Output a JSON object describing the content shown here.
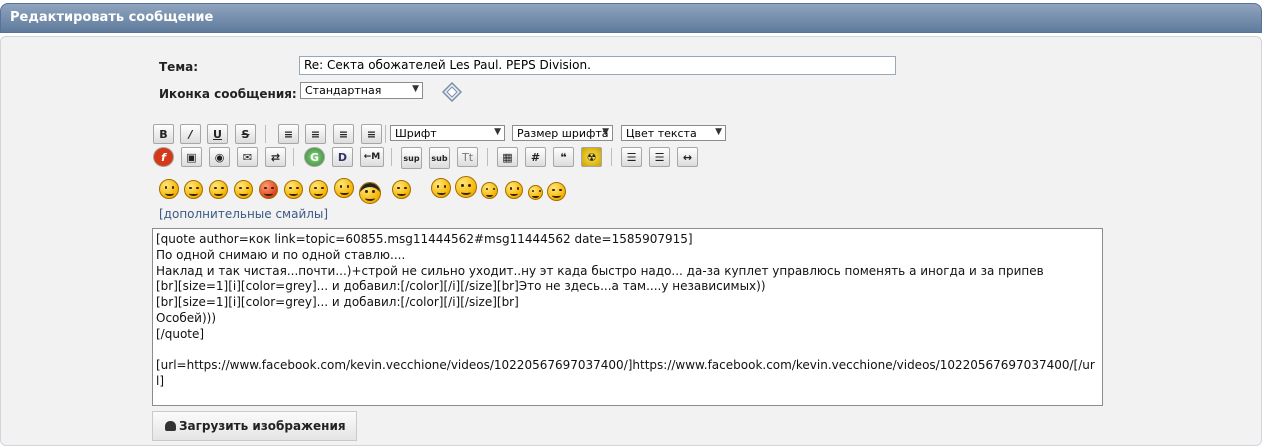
{
  "window": {
    "title": "Редактировать сообщение"
  },
  "form": {
    "subject_label": "Тема:",
    "subject_value": "Re: Секта обожателей Les Paul. PEPS Division.",
    "icon_label": "Иконка сообщения:",
    "icon_value": "Стандартная"
  },
  "toolbar": {
    "font_select": "Шрифт",
    "size_select": "Размер шрифта",
    "color_select": "Цвет текста",
    "row1_buttons": [
      {
        "name": "bold-button",
        "glyph": "B"
      },
      {
        "name": "italic-button",
        "glyph": "/"
      },
      {
        "name": "underline-button",
        "glyph": "U"
      },
      {
        "name": "strike-button",
        "glyph": "S"
      },
      {
        "name": "align-left-button",
        "glyph": "≡"
      },
      {
        "name": "align-justify-button",
        "glyph": "≡"
      },
      {
        "name": "align-center-button",
        "glyph": "≡"
      },
      {
        "name": "align-right-button",
        "glyph": "≡"
      }
    ],
    "row2_buttons": [
      {
        "name": "flash-button",
        "glyph": "f"
      },
      {
        "name": "image-button",
        "glyph": "▣"
      },
      {
        "name": "link-button",
        "glyph": "◉"
      },
      {
        "name": "email-button",
        "glyph": "✉"
      },
      {
        "name": "ftp-button",
        "glyph": "⇄"
      },
      {
        "name": "glow-button",
        "glyph": "G"
      },
      {
        "name": "shadow-button",
        "glyph": "D"
      },
      {
        "name": "marquee-button",
        "glyph": "←M"
      },
      {
        "name": "superscript-button",
        "glyph": "sup"
      },
      {
        "name": "subscript-button",
        "glyph": "sub"
      },
      {
        "name": "teletype-button",
        "glyph": "Tt"
      },
      {
        "name": "table-button",
        "glyph": "▦"
      },
      {
        "name": "code-button",
        "glyph": "#"
      },
      {
        "name": "quote-button",
        "glyph": "❝"
      },
      {
        "name": "nuke-button",
        "glyph": "☢"
      },
      {
        "name": "list-button",
        "glyph": "☰"
      },
      {
        "name": "ordered-list-button",
        "glyph": "☰"
      },
      {
        "name": "horizontal-rule-button",
        "glyph": "↔"
      }
    ]
  },
  "smileys": {
    "more_link": "[дополнительные смайлы]"
  },
  "editor": {
    "text": "[quote author=кок link=topic=60855.msg11444562#msg11444562 date=1585907915]\nПо одной снимаю и по одной ставлю....\nНаклад и так чистая...почти...)+строй не сильно уходит..ну эт када быстро надо... да-за куплет управлюсь поменять а иногда и за припев\n[br][size=1][i][color=grey]... и добавил:[/color][/i][/size][br]Это не здесь...а там....у независимых))\n[br][size=1][i][color=grey]... и добавил:[/color][/i][/size][br]\nОсобей)))\n[/quote]\n\n[url=https://www.facebook.com/kevin.vecchione/videos/10220567697037400/]https://www.facebook.com/kevin.vecchione/videos/10220567697037400/[/url]"
  },
  "upload": {
    "label": "Загрузить изображения"
  }
}
